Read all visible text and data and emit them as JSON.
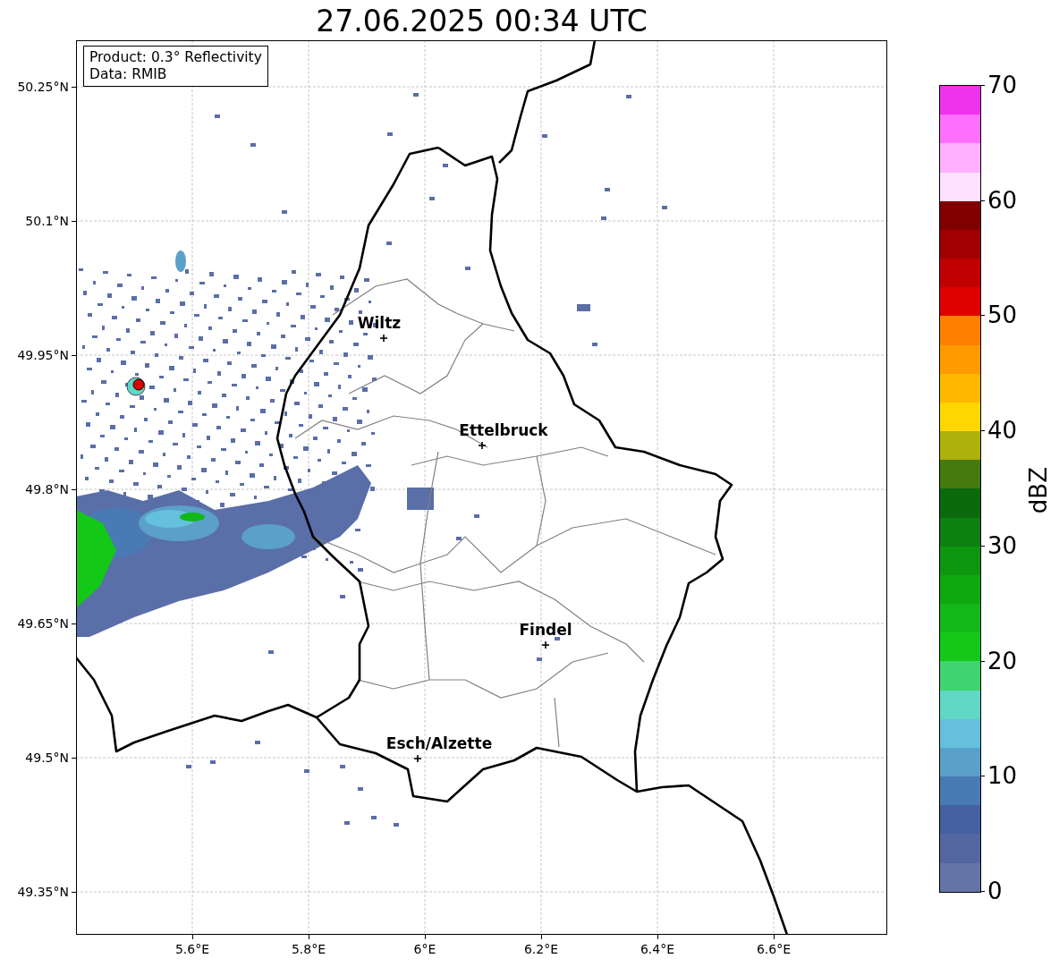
{
  "title": "27.06.2025 00:34 UTC",
  "info_box": [
    "Product: 0.3° Reflectivity",
    "Data: RMIB"
  ],
  "lat_ticks": [
    "50.25°N",
    "50.1°N",
    "49.95°N",
    "49.8°N",
    "49.65°N",
    "49.5°N",
    "49.35°N"
  ],
  "lon_ticks": [
    "5.6°E",
    "5.8°E",
    "6°E",
    "6.2°E",
    "6.4°E",
    "6.6°E"
  ],
  "cities": [
    {
      "name": "Wiltz",
      "kind": "left"
    },
    {
      "name": "Ettelbruck",
      "kind": "right"
    },
    {
      "name": "Findel",
      "kind": "center"
    },
    {
      "name": "Esch/Alzette",
      "kind": "right"
    }
  ],
  "colorbar": {
    "label": "dBZ",
    "ticks": [
      "70",
      "60",
      "50",
      "40",
      "30",
      "20",
      "10",
      "0"
    ],
    "segments": [
      {
        "color": "#6474a6"
      },
      {
        "color": "#5366a0"
      },
      {
        "color": "#4560a0"
      },
      {
        "color": "#4a7ab4"
      },
      {
        "color": "#5aa0c8"
      },
      {
        "color": "#64c0dc"
      },
      {
        "color": "#60d8c4"
      },
      {
        "color": "#3fd46f"
      },
      {
        "color": "#14c818"
      },
      {
        "color": "#12b818"
      },
      {
        "color": "#10a810"
      },
      {
        "color": "#0e9610"
      },
      {
        "color": "#0c8010"
      },
      {
        "color": "#0a6a0c"
      },
      {
        "color": "#457a0c"
      },
      {
        "color": "#b0b00a"
      },
      {
        "color": "#ffd700"
      },
      {
        "color": "#ffb800"
      },
      {
        "color": "#ff9b00"
      },
      {
        "color": "#ff7f00"
      },
      {
        "color": "#e00000"
      },
      {
        "color": "#c00000"
      },
      {
        "color": "#a00000"
      },
      {
        "color": "#800000"
      },
      {
        "color": "#ffe0ff"
      },
      {
        "color": "#ffb0ff"
      },
      {
        "color": "#ff70ff"
      },
      {
        "color": "#ee33ee"
      }
    ]
  }
}
